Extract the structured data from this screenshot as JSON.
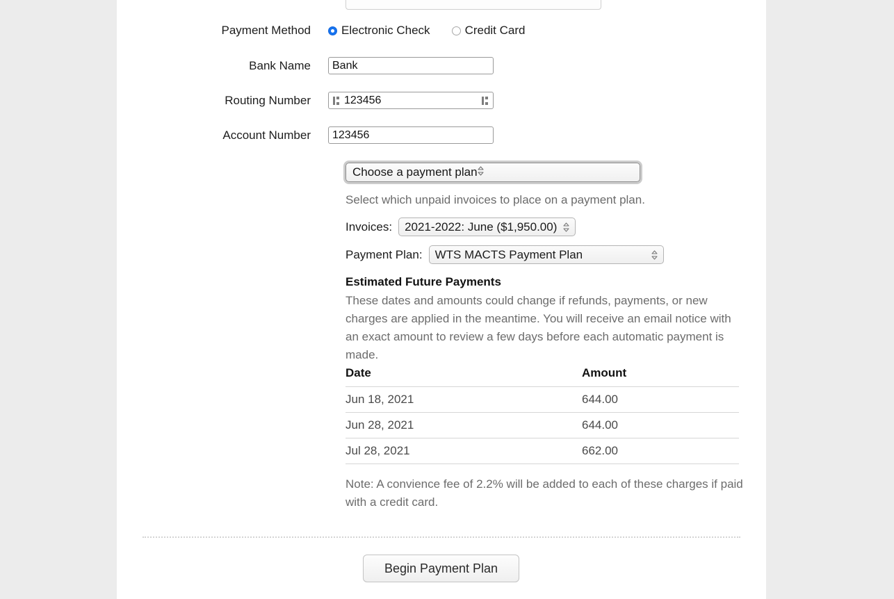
{
  "form": {
    "payment_method": {
      "label": "Payment Method",
      "options": [
        {
          "label": "Electronic Check",
          "selected": true
        },
        {
          "label": "Credit Card",
          "selected": false
        }
      ]
    },
    "bank_name": {
      "label": "Bank Name",
      "value": "Bank"
    },
    "routing_number": {
      "label": "Routing Number",
      "value": "123456"
    },
    "account_number": {
      "label": "Account Number",
      "value": "123456"
    }
  },
  "plan_section": {
    "plan_select_value": "Choose a payment plan",
    "helper_text": "Select which unpaid invoices to place on a payment plan.",
    "invoices_label": "Invoices:",
    "invoices_value": "2021-2022: June ($1,950.00)",
    "payment_plan_label": "Payment Plan:",
    "payment_plan_value": "WTS MACTS Payment Plan"
  },
  "estimated": {
    "title": "Estimated Future Payments",
    "description": "These dates and amounts could change if refunds, payments, or new charges are applied in the meantime. You will receive an email notice with an exact amount to review a few days before each automatic payment is made.",
    "columns": {
      "date": "Date",
      "amount": "Amount"
    },
    "rows": [
      {
        "date": "Jun 18, 2021",
        "amount": "644.00"
      },
      {
        "date": "Jun 28, 2021",
        "amount": "644.00"
      },
      {
        "date": "Jul 28, 2021",
        "amount": "662.00"
      }
    ],
    "note": "Note: A convience fee of 2.2% will be added to each of these charges if paid with a credit card."
  },
  "footer": {
    "submit_label": "Begin Payment Plan"
  },
  "colors": {
    "radio_accent": "#1673f0",
    "page_background": "#ececec",
    "panel_background": "#ffffff",
    "muted_text": "#6c6c6c",
    "rule": "#d6d6d6"
  }
}
